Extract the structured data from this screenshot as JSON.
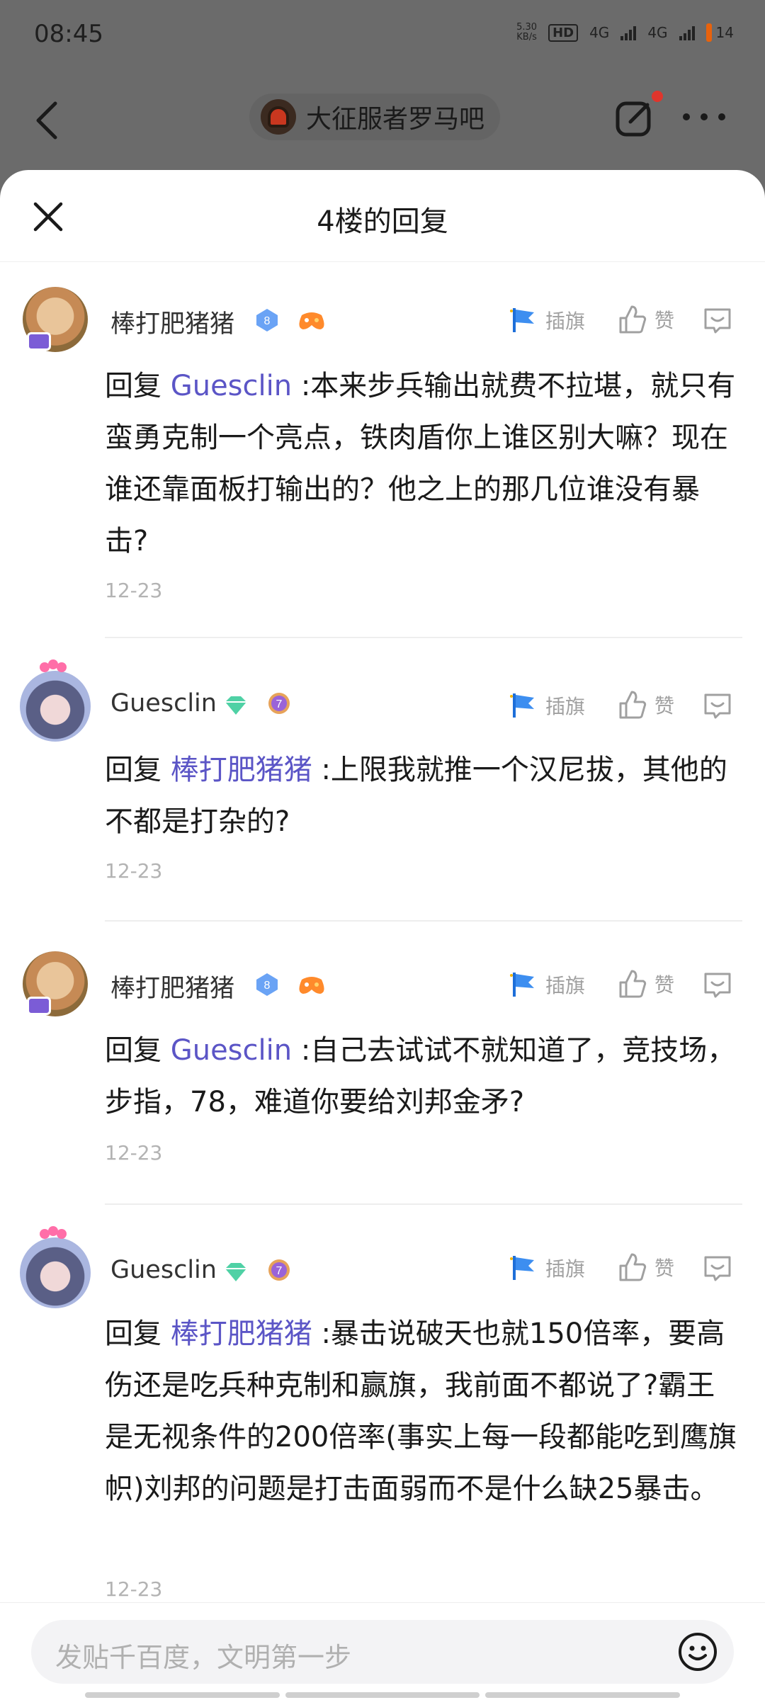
{
  "status_bar": {
    "time": "08:45",
    "net_speed_value": "5.30",
    "net_speed_unit": "KB/s",
    "hd_label": "HD",
    "network_1": "4G",
    "network_2": "4G",
    "battery": "14"
  },
  "top_bar": {
    "forum_name": "大征服者罗马吧"
  },
  "sheet": {
    "title": "4楼的回复"
  },
  "actions": {
    "flag_label": "插旗",
    "like_label": "赞"
  },
  "replies": [
    {
      "username": "棒打肥猪猪",
      "level": "8",
      "reply_prefix": "回复",
      "reply_to": "Guesclin",
      "text": ":本来步兵输出就费不拉堪，就只有蛮勇克制一个亮点，铁肉盾你上谁区别大嘛？现在谁还靠面板打输出的？他之上的那几位谁没有暴击?",
      "date": "12-23"
    },
    {
      "username": "Guesclin",
      "level": "7",
      "reply_prefix": "回复",
      "reply_to": "棒打肥猪猪",
      "text": ":上限我就推一个汉尼拔，其他的不都是打杂的?",
      "date": "12-23"
    },
    {
      "username": "棒打肥猪猪",
      "level": "8",
      "reply_prefix": "回复",
      "reply_to": "Guesclin",
      "text": ":自己去试试不就知道了，竞技场，步指，78，难道你要给刘邦金矛?",
      "date": "12-23"
    },
    {
      "username": "Guesclin",
      "level": "7",
      "reply_prefix": "回复",
      "reply_to": "棒打肥猪猪",
      "text": ":暴击说破天也就150倍率，要高伤还是吃兵种克制和赢旗，我前面不都说了?霸王是无视条件的200倍率(事实上每一段都能吃到鹰旗帜)刘邦的问题是打击面弱而不是什么缺25暴击。",
      "date": "12-23"
    }
  ],
  "composer": {
    "placeholder": "发贴千百度，文明第一步"
  },
  "colors": {
    "mention": "#5b55c6",
    "accent_red": "#e0352c",
    "overlay": "#6b6b6b"
  }
}
